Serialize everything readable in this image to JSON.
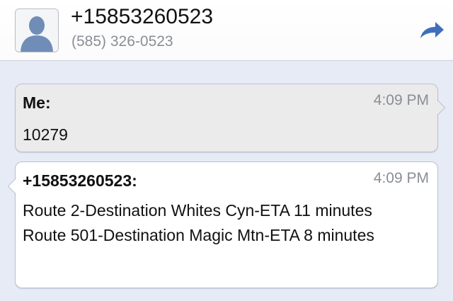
{
  "contact": {
    "name": "+15853260523",
    "number": "(585) 326-0523"
  },
  "icons": {
    "avatar": "person-silhouette-icon",
    "forward": "curved-forward-arrow-icon"
  },
  "colors": {
    "background": "#e6ebf5",
    "sent_bubble": "#ebebeb",
    "received_bubble": "#ffffff",
    "forward_icon": "#3f6fba",
    "secondary_text": "#8a8e95"
  },
  "messages": [
    {
      "sender": "Me:",
      "time": "4:09 PM",
      "text": "10279"
    },
    {
      "sender": "+15853260523:",
      "time": "4:09 PM",
      "text": "Route 2-Destination Whites Cyn-ETA 11 minutes Route 501-Destination Magic Mtn-ETA 8 minutes"
    }
  ]
}
